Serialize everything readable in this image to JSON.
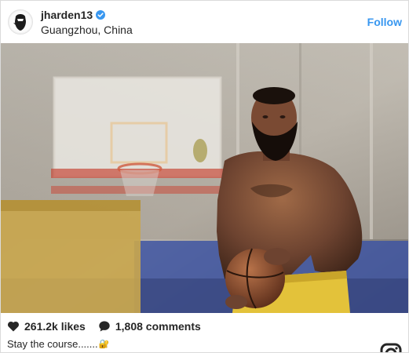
{
  "header": {
    "username": "jharden13",
    "location": "Guangzhou, China",
    "follow_label": "Follow",
    "verified_icon": "verified-badge-icon",
    "avatar_icon": "beard-logo-icon"
  },
  "photo": {
    "description_icon": "post-photo"
  },
  "actions": {
    "likes": "261.2k likes",
    "comments": "1,808 comments",
    "heart_icon": "heart-icon",
    "comment_icon": "comment-icon"
  },
  "caption": {
    "text": "Stay the course.......",
    "emoji": "🔐"
  },
  "colors": {
    "accent": "#3897f0",
    "text": "#262626"
  }
}
